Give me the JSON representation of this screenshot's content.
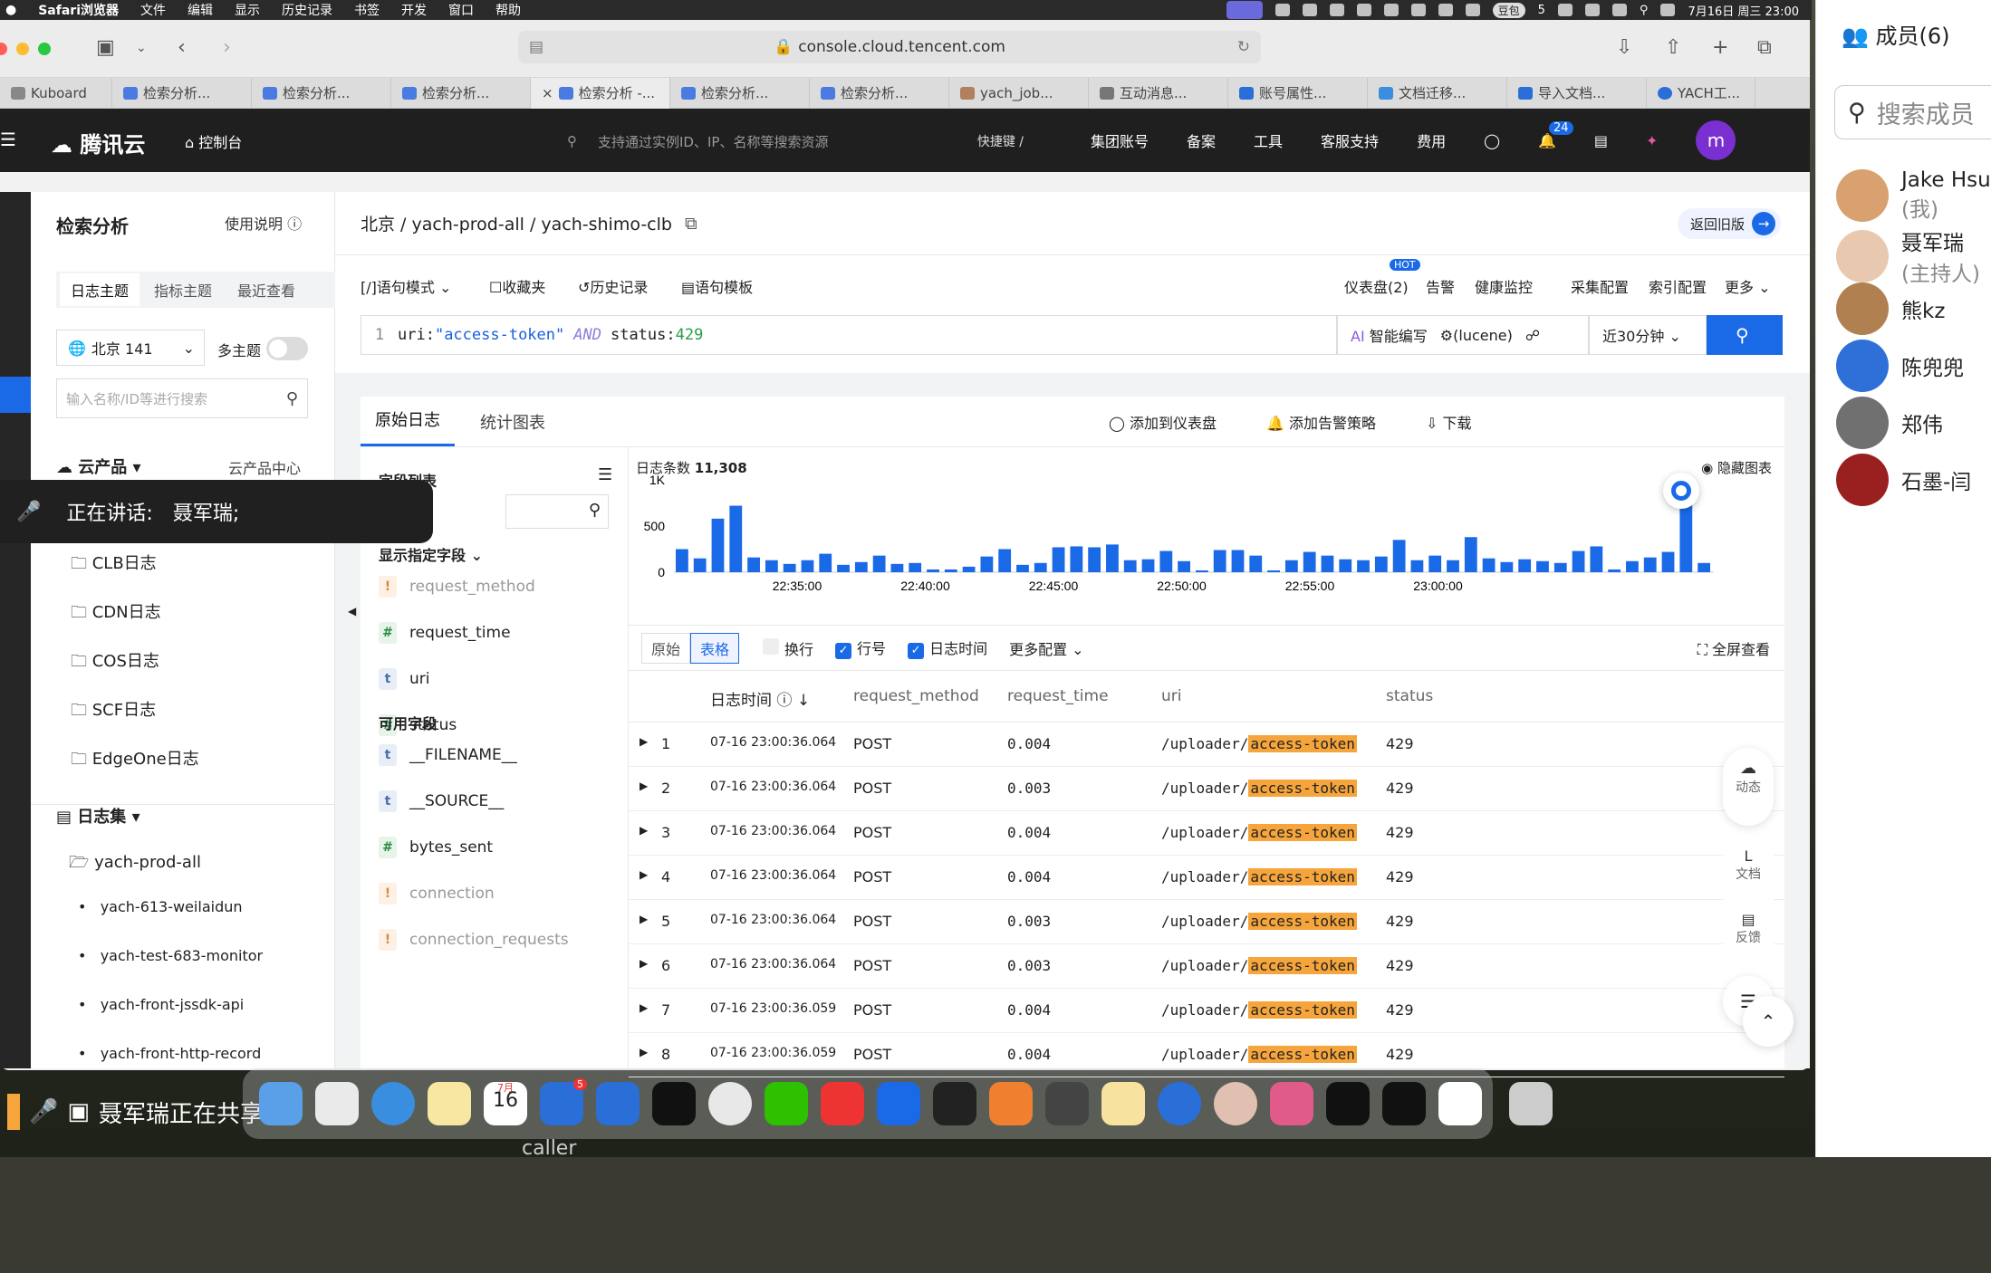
{
  "menubar": {
    "app": "Safari浏览器",
    "items": [
      "文件",
      "编辑",
      "显示",
      "历史记录",
      "书签",
      "开发",
      "窗口",
      "帮助"
    ],
    "badge_a": "豆包",
    "count": "5",
    "clock": "7月16日 周三  23:00"
  },
  "browser": {
    "url": "console.cloud.tencent.com",
    "tabs": [
      "Kuboard",
      "检索分析...",
      "检索分析...",
      "检索分析...",
      "检索分析 -...",
      "检索分析...",
      "检索分析...",
      "yach_job...",
      "互动消息...",
      "账号属性...",
      "文档迁移...",
      "导入文档...",
      "YACH工..."
    ]
  },
  "topnav": {
    "logo": "腾讯云",
    "console": "控制台",
    "search_placeholder": "支持通过实例ID、IP、名称等搜索资源",
    "shortcut": "快捷键 /",
    "items": [
      "集团账号",
      "备案",
      "工具",
      "客服支持",
      "费用"
    ],
    "bell_count": "24",
    "avatar": "m"
  },
  "sidebar": {
    "title": "检索分析",
    "help": "使用说明",
    "tabs": [
      "日志主题",
      "指标主题",
      "最近查看"
    ],
    "region": "北京 141",
    "multi_topic": "多主题",
    "search_placeholder": "输入名称/ID等进行搜索",
    "cloud_products": "云产品 ▾",
    "cloud_center": "云产品中心",
    "products": [
      "CLB日志",
      "CDN日志",
      "COS日志",
      "SCF日志",
      "EdgeOne日志"
    ],
    "logsets_label": "日志集 ▾",
    "logset": "yach-prod-all",
    "topics": [
      "yach-613-weilaidun",
      "yach-test-683-monitor",
      "yach-front-jssdk-api",
      "yach-front-http-record"
    ]
  },
  "speaking": {
    "label": "正在讲话:",
    "name": "聂军瑞;"
  },
  "main": {
    "breadcrumb": "北京 / yach-prod-all / yach-shimo-clb",
    "back_old": "返回旧版",
    "tools": [
      "[/]语句模式 ⌄",
      "收藏夹",
      "历史记录",
      "语句模板"
    ],
    "right_tools": [
      "仪表盘(2)",
      "告警",
      "健康监控",
      "采集配置",
      "索引配置",
      "更多 ⌄"
    ],
    "hot": "HOT",
    "query": {
      "line": "1",
      "field1": "uri:",
      "value1": "\"access-token\"",
      "op": "AND",
      "field2": "status:",
      "value2": "429"
    },
    "ai_write": "智能编写",
    "lucene": "(lucene)",
    "time_range": "近30分钟 ⌄"
  },
  "panel": {
    "tabs": [
      "原始日志",
      "统计图表"
    ],
    "actions": [
      "添加到仪表盘",
      "添加告警策略",
      "下载"
    ],
    "field_list": "字段列表",
    "shown_fields_label": "显示指定字段 ⌄",
    "shown_fields": [
      {
        "type": "!",
        "name": "request_method",
        "dim": true
      },
      {
        "type": "#",
        "name": "request_time",
        "dim": false
      },
      {
        "type": "t",
        "name": "uri",
        "dim": false
      },
      {
        "type": "#",
        "name": "status",
        "dim": false
      }
    ],
    "available_label": "可用字段",
    "available_fields": [
      {
        "type": "t",
        "name": "__FILENAME__",
        "dim": false
      },
      {
        "type": "t",
        "name": "__SOURCE__",
        "dim": false
      },
      {
        "type": "#",
        "name": "bytes_sent",
        "dim": false
      },
      {
        "type": "!",
        "name": "connection",
        "dim": true
      },
      {
        "type": "!",
        "name": "connection_requests",
        "dim": true
      }
    ],
    "log_count_label": "日志条数",
    "log_count": "11,308",
    "hide_chart": "隐藏图表",
    "table_tools": {
      "raw": "原始",
      "table": "表格",
      "wrap": "换行",
      "line_no": "行号",
      "log_time": "日志时间",
      "more": "更多配置 ⌄",
      "fullscreen": "全屏查看"
    },
    "columns": [
      "日志时间",
      "request_method",
      "request_time",
      "uri",
      "status"
    ],
    "uri_prefix": "/uploader/",
    "rows": [
      {
        "n": "1",
        "time": "07-16 23:00:36.064",
        "method": "POST",
        "rt": "0.004",
        "uri": "access-token",
        "status": "429"
      },
      {
        "n": "2",
        "time": "07-16 23:00:36.064",
        "method": "POST",
        "rt": "0.003",
        "uri": "access-token",
        "status": "429"
      },
      {
        "n": "3",
        "time": "07-16 23:00:36.064",
        "method": "POST",
        "rt": "0.004",
        "uri": "access-token",
        "status": "429"
      },
      {
        "n": "4",
        "time": "07-16 23:00:36.064",
        "method": "POST",
        "rt": "0.004",
        "uri": "access-token",
        "status": "429"
      },
      {
        "n": "5",
        "time": "07-16 23:00:36.064",
        "method": "POST",
        "rt": "0.003",
        "uri": "access-token",
        "status": "429"
      },
      {
        "n": "6",
        "time": "07-16 23:00:36.064",
        "method": "POST",
        "rt": "0.003",
        "uri": "access-token",
        "status": "429"
      },
      {
        "n": "7",
        "time": "07-16 23:00:36.059",
        "method": "POST",
        "rt": "0.004",
        "uri": "access-token",
        "status": "429"
      },
      {
        "n": "8",
        "time": "07-16 23:00:36.059",
        "method": "POST",
        "rt": "0.004",
        "uri": "access-token",
        "status": "429"
      }
    ],
    "float_tools": [
      "动态",
      "文档",
      "反馈"
    ]
  },
  "chart_data": {
    "type": "bar",
    "y_ticks": [
      "0",
      "500",
      "1K"
    ],
    "ylim": [
      0,
      1000
    ],
    "x_ticks": [
      "22:35:00",
      "22:40:00",
      "22:45:00",
      "22:50:00",
      "22:55:00",
      "23:00:00"
    ],
    "values": [
      250,
      150,
      580,
      720,
      160,
      130,
      90,
      130,
      200,
      80,
      110,
      180,
      90,
      100,
      30,
      30,
      60,
      170,
      250,
      80,
      100,
      270,
      280,
      270,
      300,
      130,
      140,
      230,
      120,
      20,
      240,
      240,
      180,
      20,
      130,
      220,
      180,
      140,
      130,
      170,
      350,
      130,
      180,
      130,
      380,
      150,
      110,
      140,
      120,
      100,
      230,
      280,
      30,
      120,
      160,
      220,
      850,
      100
    ],
    "bar_color": "#1a6ae8"
  },
  "members": {
    "title": "成员(6)",
    "search": "搜索成员",
    "list": [
      {
        "name": "Jake Hsu",
        "sub": "(我)",
        "color": "#d9a070"
      },
      {
        "name": "聂军瑞",
        "sub": "(主持人)",
        "color": "#e8c9b0"
      },
      {
        "name": "熊kz",
        "sub": "",
        "color": "#b08050"
      },
      {
        "name": "陈兜兜",
        "sub": "",
        "color": "#2f6fd8"
      },
      {
        "name": "郑伟",
        "sub": "",
        "color": "#707070"
      },
      {
        "name": "石墨-闫",
        "sub": "",
        "color": "#9a2020"
      }
    ]
  },
  "dock": {
    "sharing": "聂军瑞正在共享",
    "calendar_month": "7月",
    "calendar_day": "16",
    "badge": "5",
    "footer_text": "caller"
  }
}
